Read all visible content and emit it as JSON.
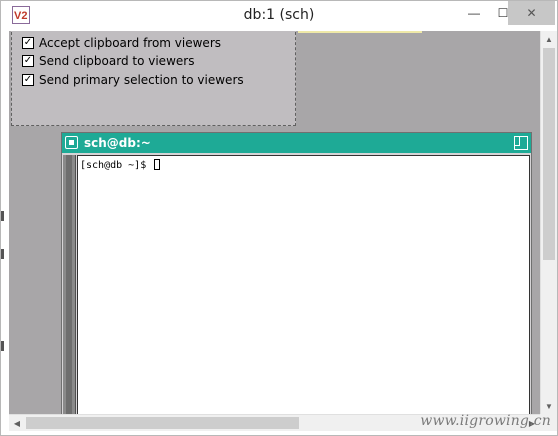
{
  "window": {
    "title": "db:1 (sch)",
    "app_icon": "vnc-viewer-icon",
    "app_icon_text": "V2",
    "controls": {
      "minimize": "—",
      "maximize": "☐",
      "close": "✕"
    }
  },
  "clipboard_panel": {
    "options": [
      {
        "label": "Accept clipboard from viewers",
        "checked": true,
        "mark": "✓"
      },
      {
        "label": "Send clipboard to viewers",
        "checked": true,
        "mark": "✓"
      },
      {
        "label": "Send primary selection to viewers",
        "checked": true,
        "mark": "✓"
      }
    ]
  },
  "xterm": {
    "title": "sch@db:~",
    "prompt": "[sch@db ~]$ ",
    "title_bar_color": "#1eaa96"
  },
  "scrollbars": {
    "up_arrow": "▲",
    "down_arrow": "▼",
    "left_arrow": "◀",
    "right_arrow": "▶"
  },
  "watermark": "www.iigrowing.cn"
}
